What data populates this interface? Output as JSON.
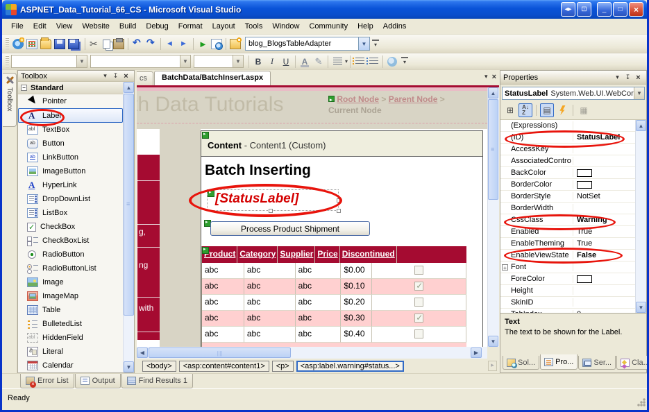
{
  "window": {
    "title": "ASPNET_Data_Tutorial_66_CS - Microsoft Visual Studio"
  },
  "menu": {
    "items": [
      "File",
      "Edit",
      "View",
      "Website",
      "Build",
      "Debug",
      "Format",
      "Layout",
      "Tools",
      "Window",
      "Community",
      "Help",
      "Addins"
    ]
  },
  "toolbar1": {
    "adapter_combo_value": "blog_BlogsTableAdapter",
    "buttons": [
      {
        "kind": "btn",
        "icon": "new-website-icon",
        "dd": "hasdd"
      },
      {
        "kind": "btn",
        "icon": "add-item-icon",
        "dd": "hasdd"
      },
      {
        "kind": "btn",
        "icon": "open-file-icon"
      },
      {
        "kind": "btn",
        "icon": "save-icon"
      },
      {
        "kind": "btn",
        "icon": "save-all-icon"
      },
      {
        "kind": "sep"
      },
      {
        "kind": "btn",
        "icon": "cut-icon"
      },
      {
        "kind": "btn",
        "icon": "copy-icon"
      },
      {
        "kind": "btn",
        "icon": "paste-icon"
      },
      {
        "kind": "sep"
      },
      {
        "kind": "btn",
        "icon": "undo-icon",
        "dd": "hasdd"
      },
      {
        "kind": "btn",
        "icon": "redo-icon",
        "dd": "hasdd"
      },
      {
        "kind": "sep"
      },
      {
        "kind": "btn",
        "icon": "navigate-back-icon",
        "dd": "hasdd"
      },
      {
        "kind": "btn",
        "icon": "navigate-forward-icon"
      },
      {
        "kind": "sep"
      },
      {
        "kind": "btn",
        "icon": "start-debug-icon"
      },
      {
        "kind": "btn",
        "icon": "view-in-browser-icon"
      },
      {
        "kind": "sep"
      },
      {
        "kind": "btn",
        "icon": "other-windows-icon"
      }
    ]
  },
  "toolbar2": {
    "bold": "B",
    "italic": "I",
    "underline": "U",
    "fontcolor": "A"
  },
  "toolbox": {
    "collapsed_tab_label": "Toolbox",
    "title": "Toolbox",
    "section_label": "Standard",
    "items": [
      {
        "label": "Pointer",
        "icon": "pointer-icon"
      },
      {
        "label": "Label",
        "icon": "label-icon",
        "row": "sel"
      },
      {
        "label": "TextBox",
        "icon": "textbox-icon"
      },
      {
        "label": "Button",
        "icon": "button-icon"
      },
      {
        "label": "LinkButton",
        "icon": "linkbutton-icon"
      },
      {
        "label": "ImageButton",
        "icon": "imagebutton-icon"
      },
      {
        "label": "HyperLink",
        "icon": "hyperlink-icon"
      },
      {
        "label": "DropDownList",
        "icon": "dropdownlist-icon"
      },
      {
        "label": "ListBox",
        "icon": "listbox-icon"
      },
      {
        "label": "CheckBox",
        "icon": "checkbox-icon"
      },
      {
        "label": "CheckBoxList",
        "icon": "checkboxlist-icon"
      },
      {
        "label": "RadioButton",
        "icon": "radiobutton-icon"
      },
      {
        "label": "RadioButtonList",
        "icon": "radiobuttonlist-icon"
      },
      {
        "label": "Image",
        "icon": "image-icon"
      },
      {
        "label": "ImageMap",
        "icon": "imagemap-icon"
      },
      {
        "label": "Table",
        "icon": "table-icon"
      },
      {
        "label": "BulletedList",
        "icon": "bulletedlist-icon"
      },
      {
        "label": "HiddenField",
        "icon": "hiddenfield-icon"
      },
      {
        "label": "Literal",
        "icon": "literal-icon"
      },
      {
        "label": "Calendar",
        "icon": "calendar-icon"
      }
    ]
  },
  "docwell": {
    "partial_tab": "cs",
    "active_tab": "BatchData/BatchInsert.aspx"
  },
  "design": {
    "banner_title": "th Data Tutorials",
    "breadcrumb": {
      "root": "Root Node",
      "sep1": ">",
      "parent": "Parent Node",
      "sep2": ">",
      "current": "Current Node"
    },
    "sidebar_fragments": [
      {
        "text": "g,",
        "top": "104"
      },
      {
        "text": "ng",
        "top": "152"
      },
      {
        "text": "with",
        "top": "214"
      }
    ],
    "content_frame_title_bold": "Content",
    "content_frame_title_rest": " - Content1 (Custom)",
    "heading": "Batch Inserting",
    "status_label": "[StatusLabel]",
    "button_label": "Process Product Shipment",
    "grid": {
      "headers": [
        "Product",
        "Category",
        "Supplier",
        "Price",
        "Discontinued"
      ],
      "rows": [
        {
          "product": "abc",
          "category": "abc",
          "supplier": "abc",
          "price": "$0.00",
          "checked": "",
          "shade": ""
        },
        {
          "product": "abc",
          "category": "abc",
          "supplier": "abc",
          "price": "$0.10",
          "checked": "checked",
          "shade": "alt"
        },
        {
          "product": "abc",
          "category": "abc",
          "supplier": "abc",
          "price": "$0.20",
          "checked": "",
          "shade": ""
        },
        {
          "product": "abc",
          "category": "abc",
          "supplier": "abc",
          "price": "$0.30",
          "checked": "checked",
          "shade": "alt"
        },
        {
          "product": "abc",
          "category": "abc",
          "supplier": "abc",
          "price": "$0.40",
          "checked": "",
          "shade": ""
        }
      ]
    }
  },
  "tagnav": {
    "items": [
      {
        "label": "<body>",
        "state": ""
      },
      {
        "label": "<asp:content#content1>",
        "state": ""
      },
      {
        "label": "<p>",
        "state": ""
      },
      {
        "label": "<asp:label.warning#status...>",
        "state": "sel"
      }
    ]
  },
  "properties": {
    "title": "Properties",
    "object_name": "StatusLabel",
    "object_type": "System.Web.UI.WebCor",
    "rows": [
      {
        "name": "(Expressions)",
        "value": "",
        "emph": "",
        "kind": "",
        "exp": ""
      },
      {
        "name": "(ID)",
        "value": "StatusLabel",
        "emph": "bold",
        "kind": "",
        "exp": ""
      },
      {
        "name": "AccessKey",
        "value": "",
        "emph": "",
        "kind": "",
        "exp": ""
      },
      {
        "name": "AssociatedContro",
        "value": "",
        "emph": "",
        "kind": "",
        "exp": ""
      },
      {
        "name": "BackColor",
        "value": "",
        "emph": "",
        "kind": "swatch",
        "exp": ""
      },
      {
        "name": "BorderColor",
        "value": "",
        "emph": "",
        "kind": "swatch",
        "exp": ""
      },
      {
        "name": "BorderStyle",
        "value": "NotSet",
        "emph": "",
        "kind": "",
        "exp": ""
      },
      {
        "name": "BorderWidth",
        "value": "",
        "emph": "",
        "kind": "",
        "exp": ""
      },
      {
        "name": "CssClass",
        "value": "Warning",
        "emph": "bold",
        "kind": "",
        "exp": ""
      },
      {
        "name": "Enabled",
        "value": "True",
        "emph": "",
        "kind": "",
        "exp": ""
      },
      {
        "name": "EnableTheming",
        "value": "True",
        "emph": "",
        "kind": "",
        "exp": ""
      },
      {
        "name": "EnableViewState",
        "value": "False",
        "emph": "bold",
        "kind": "",
        "exp": ""
      },
      {
        "name": "Font",
        "value": "",
        "emph": "",
        "kind": "",
        "exp": "+"
      },
      {
        "name": "ForeColor",
        "value": "",
        "emph": "",
        "kind": "swatch",
        "exp": ""
      },
      {
        "name": "Height",
        "value": "",
        "emph": "",
        "kind": "",
        "exp": ""
      },
      {
        "name": "SkinID",
        "value": "",
        "emph": "",
        "kind": "",
        "exp": ""
      },
      {
        "name": "TabIndex",
        "value": "0",
        "emph": "",
        "kind": "",
        "exp": ""
      }
    ],
    "description_title": "Text",
    "description_body": "The text to be shown for the Label.",
    "tabs": [
      {
        "label": "Sol...",
        "icon": "solution-icon",
        "state": ""
      },
      {
        "label": "Pro...",
        "icon": "properties-tab-icon",
        "state": "active"
      },
      {
        "label": "Ser...",
        "icon": "server-icon",
        "state": ""
      },
      {
        "label": "Cla...",
        "icon": "classview-icon",
        "state": ""
      }
    ]
  },
  "bottom": {
    "tabs": [
      {
        "label": "Error List",
        "icon": "errorlist-icon"
      },
      {
        "label": "Output",
        "icon": "output-icon"
      },
      {
        "label": "Find Results 1",
        "icon": "findresults-icon"
      }
    ],
    "status": "Ready"
  },
  "colors": {
    "accent_red": "#A50B31",
    "pink_row": "#FFD0D0",
    "annotation_red": "#E8140C",
    "xp_tan": "#ECE9D8"
  }
}
